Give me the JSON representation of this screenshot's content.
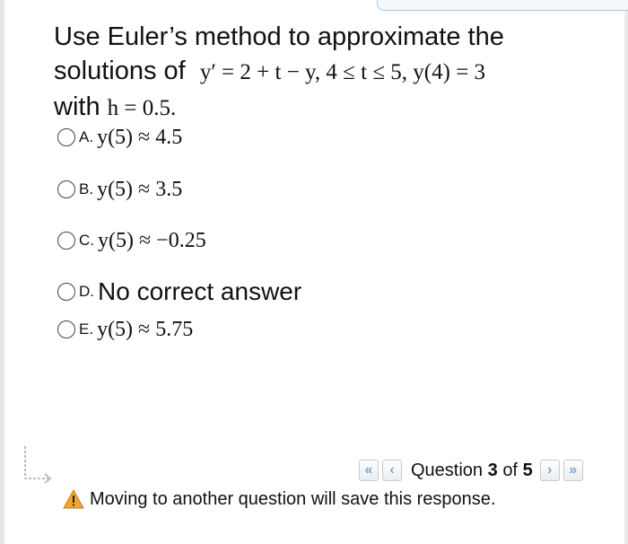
{
  "question": {
    "line1": "Use Euler’s method to approximate the",
    "line2_text": "solutions of",
    "equation": "y′ = 2 + t − y,  4 ≤ t ≤ 5,  y(4) = 3",
    "line3_text": "with",
    "step": "h = 0.5."
  },
  "options": [
    {
      "letter": "A.",
      "math": "y(5) ≈ 4.5"
    },
    {
      "letter": "B.",
      "math": "y(5) ≈ 3.5"
    },
    {
      "letter": "C.",
      "math": "y(5) ≈ −0.25"
    },
    {
      "letter": "D.",
      "text": "No correct answer"
    },
    {
      "letter": "E.",
      "math": "y(5) ≈ 5.75"
    }
  ],
  "navigation": {
    "first_icon": "«",
    "prev_icon": "‹",
    "next_icon": "›",
    "last_icon": "»",
    "label_prefix": "Question",
    "current": "3",
    "label_mid": "of",
    "total": "5"
  },
  "warning": {
    "icon": "warning-triangle",
    "text": "Moving to another question will save this response."
  },
  "colors": {
    "nav_arrow": "#7aa6c6",
    "warning_fill": "#f2a531"
  }
}
